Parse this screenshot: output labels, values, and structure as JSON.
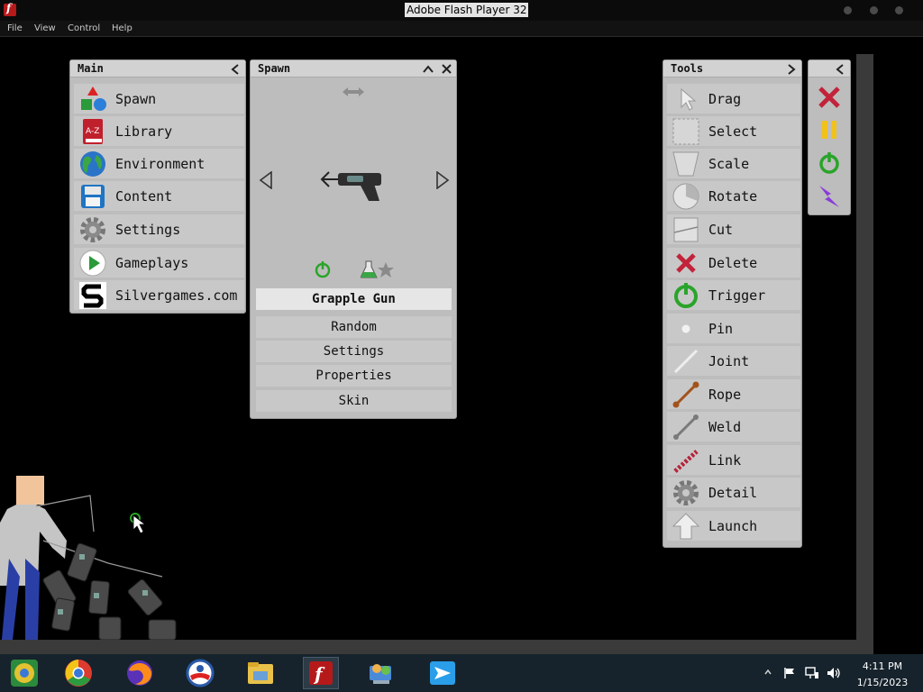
{
  "window": {
    "title": "Adobe Flash Player 32"
  },
  "menubar": {
    "file": "File",
    "view": "View",
    "control": "Control",
    "help": "Help"
  },
  "main_panel": {
    "title": "Main",
    "items": [
      {
        "label": "Spawn",
        "icon": "shapes-icon"
      },
      {
        "label": "Library",
        "icon": "book-icon"
      },
      {
        "label": "Environment",
        "icon": "globe-icon"
      },
      {
        "label": "Content",
        "icon": "floppy-disk-icon"
      },
      {
        "label": "Settings",
        "icon": "gear-icon"
      },
      {
        "label": "Gameplays",
        "icon": "play-icon"
      },
      {
        "label": "Silvergames.com",
        "icon": "silvergames-logo-icon"
      }
    ]
  },
  "spawn_panel": {
    "title": "Spawn",
    "item_name": "Grapple Gun",
    "buttons": {
      "random": "Random",
      "settings": "Settings",
      "properties": "Properties",
      "skin": "Skin"
    }
  },
  "tools_panel": {
    "title": "Tools",
    "items": [
      {
        "label": "Drag",
        "icon": "cursor-icon"
      },
      {
        "label": "Select",
        "icon": "select-box-icon"
      },
      {
        "label": "Scale",
        "icon": "scale-icon"
      },
      {
        "label": "Rotate",
        "icon": "rotate-icon"
      },
      {
        "label": "Cut",
        "icon": "cut-icon"
      },
      {
        "label": "Delete",
        "icon": "delete-icon"
      },
      {
        "label": "Trigger",
        "icon": "power-icon"
      },
      {
        "label": "Pin",
        "icon": "pin-icon"
      },
      {
        "label": "Joint",
        "icon": "joint-icon"
      },
      {
        "label": "Rope",
        "icon": "rope-icon"
      },
      {
        "label": "Weld",
        "icon": "weld-icon"
      },
      {
        "label": "Link",
        "icon": "link-icon"
      },
      {
        "label": "Detail",
        "icon": "detail-gear-icon"
      },
      {
        "label": "Launch",
        "icon": "launch-arrow-icon"
      }
    ]
  },
  "taskbar": {
    "time": "4:11 PM",
    "date": "1/15/2023"
  },
  "colors": {
    "panel": "#bdbdbd",
    "row": "#c8c8c8",
    "header": "#d2d2d2",
    "delete_red": "#c2233a",
    "pause_yellow": "#f1c21a",
    "trigger_green": "#2aa42a",
    "flash_red": "#b51919",
    "taskbar": "#16232c"
  }
}
